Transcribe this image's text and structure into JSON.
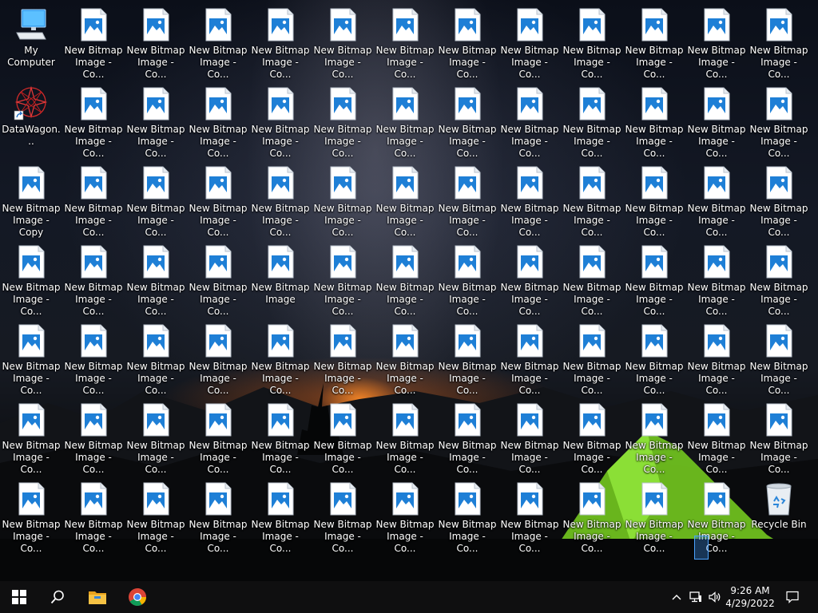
{
  "desktop": {
    "icons": [
      {
        "label": "My Computer",
        "type": "computer"
      },
      {
        "label": "New Bitmap Image - Co...",
        "type": "bitmap"
      },
      {
        "label": "New Bitmap Image - Co...",
        "type": "bitmap"
      },
      {
        "label": "New Bitmap Image - Co...",
        "type": "bitmap"
      },
      {
        "label": "New Bitmap Image - Co...",
        "type": "bitmap"
      },
      {
        "label": "New Bitmap Image - Co...",
        "type": "bitmap"
      },
      {
        "label": "New Bitmap Image - Co...",
        "type": "bitmap"
      },
      {
        "label": "New Bitmap Image - Co...",
        "type": "bitmap"
      },
      {
        "label": "New Bitmap Image - Co...",
        "type": "bitmap"
      },
      {
        "label": "New Bitmap Image - Co...",
        "type": "bitmap"
      },
      {
        "label": "New Bitmap Image - Co...",
        "type": "bitmap"
      },
      {
        "label": "New Bitmap Image - Co...",
        "type": "bitmap"
      },
      {
        "label": "New Bitmap Image - Co...",
        "type": "bitmap"
      },
      {
        "label": "DataWagon...",
        "type": "datawagon"
      },
      {
        "label": "New Bitmap Image - Co...",
        "type": "bitmap"
      },
      {
        "label": "New Bitmap Image - Co...",
        "type": "bitmap"
      },
      {
        "label": "New Bitmap Image - Co...",
        "type": "bitmap"
      },
      {
        "label": "New Bitmap Image - Co...",
        "type": "bitmap"
      },
      {
        "label": "New Bitmap Image - Co...",
        "type": "bitmap"
      },
      {
        "label": "New Bitmap Image - Co...",
        "type": "bitmap"
      },
      {
        "label": "New Bitmap Image - Co...",
        "type": "bitmap"
      },
      {
        "label": "New Bitmap Image - Co...",
        "type": "bitmap"
      },
      {
        "label": "New Bitmap Image - Co...",
        "type": "bitmap"
      },
      {
        "label": "New Bitmap Image - Co...",
        "type": "bitmap"
      },
      {
        "label": "New Bitmap Image - Co...",
        "type": "bitmap"
      },
      {
        "label": "New Bitmap Image - Co...",
        "type": "bitmap"
      },
      {
        "label": "New Bitmap Image - Copy",
        "type": "bitmap"
      },
      {
        "label": "New Bitmap Image - Co...",
        "type": "bitmap"
      },
      {
        "label": "New Bitmap Image - Co...",
        "type": "bitmap"
      },
      {
        "label": "New Bitmap Image - Co...",
        "type": "bitmap"
      },
      {
        "label": "New Bitmap Image - Co...",
        "type": "bitmap"
      },
      {
        "label": "New Bitmap Image - Co...",
        "type": "bitmap"
      },
      {
        "label": "New Bitmap Image - Co...",
        "type": "bitmap"
      },
      {
        "label": "New Bitmap Image - Co...",
        "type": "bitmap"
      },
      {
        "label": "New Bitmap Image - Co...",
        "type": "bitmap"
      },
      {
        "label": "New Bitmap Image - Co...",
        "type": "bitmap"
      },
      {
        "label": "New Bitmap Image - Co...",
        "type": "bitmap"
      },
      {
        "label": "New Bitmap Image - Co...",
        "type": "bitmap"
      },
      {
        "label": "New Bitmap Image - Co...",
        "type": "bitmap"
      },
      {
        "label": "New Bitmap Image - Co...",
        "type": "bitmap"
      },
      {
        "label": "New Bitmap Image - Co...",
        "type": "bitmap"
      },
      {
        "label": "New Bitmap Image - Co...",
        "type": "bitmap"
      },
      {
        "label": "New Bitmap Image - Co...",
        "type": "bitmap"
      },
      {
        "label": "New Bitmap Image",
        "type": "bitmap"
      },
      {
        "label": "New Bitmap Image - Co...",
        "type": "bitmap"
      },
      {
        "label": "New Bitmap Image - Co...",
        "type": "bitmap"
      },
      {
        "label": "New Bitmap Image - Co...",
        "type": "bitmap"
      },
      {
        "label": "New Bitmap Image - Co...",
        "type": "bitmap"
      },
      {
        "label": "New Bitmap Image - Co...",
        "type": "bitmap"
      },
      {
        "label": "New Bitmap Image - Co...",
        "type": "bitmap"
      },
      {
        "label": "New Bitmap Image - Co...",
        "type": "bitmap"
      },
      {
        "label": "New Bitmap Image - Co...",
        "type": "bitmap"
      },
      {
        "label": "New Bitmap Image - Co...",
        "type": "bitmap"
      },
      {
        "label": "New Bitmap Image - Co...",
        "type": "bitmap"
      },
      {
        "label": "New Bitmap Image - Co...",
        "type": "bitmap"
      },
      {
        "label": "New Bitmap Image - Co...",
        "type": "bitmap"
      },
      {
        "label": "New Bitmap Image - Co...",
        "type": "bitmap"
      },
      {
        "label": "New Bitmap Image - Co...",
        "type": "bitmap"
      },
      {
        "label": "New Bitmap Image - Co...",
        "type": "bitmap"
      },
      {
        "label": "New Bitmap Image - Co...",
        "type": "bitmap"
      },
      {
        "label": "New Bitmap Image - Co...",
        "type": "bitmap"
      },
      {
        "label": "New Bitmap Image - Co...",
        "type": "bitmap"
      },
      {
        "label": "New Bitmap Image - Co...",
        "type": "bitmap"
      },
      {
        "label": "New Bitmap Image - Co...",
        "type": "bitmap"
      },
      {
        "label": "New Bitmap Image - Co...",
        "type": "bitmap"
      },
      {
        "label": "New Bitmap Image - Co...",
        "type": "bitmap"
      },
      {
        "label": "New Bitmap Image - Co...",
        "type": "bitmap"
      },
      {
        "label": "New Bitmap Image - Co...",
        "type": "bitmap"
      },
      {
        "label": "New Bitmap Image - Co...",
        "type": "bitmap"
      },
      {
        "label": "New Bitmap Image - Co...",
        "type": "bitmap"
      },
      {
        "label": "New Bitmap Image - Co...",
        "type": "bitmap"
      },
      {
        "label": "New Bitmap Image - Co...",
        "type": "bitmap"
      },
      {
        "label": "New Bitmap Image - Co...",
        "type": "bitmap"
      },
      {
        "label": "New Bitmap Image - Co...",
        "type": "bitmap"
      },
      {
        "label": "New Bitmap Image - Co...",
        "type": "bitmap"
      },
      {
        "label": "New Bitmap Image - Co...",
        "type": "bitmap"
      },
      {
        "label": "New Bitmap Image - Co...",
        "type": "bitmap"
      },
      {
        "label": "New Bitmap Image - Co...",
        "type": "bitmap"
      },
      {
        "label": "New Bitmap Image - Co...",
        "type": "bitmap"
      },
      {
        "label": "New Bitmap Image - Co...",
        "type": "bitmap"
      },
      {
        "label": "New Bitmap Image - Co...",
        "type": "bitmap"
      },
      {
        "label": "New Bitmap Image - Co...",
        "type": "bitmap"
      },
      {
        "label": "New Bitmap Image - Co...",
        "type": "bitmap"
      },
      {
        "label": "New Bitmap Image - Co...",
        "type": "bitmap"
      },
      {
        "label": "New Bitmap Image - Co...",
        "type": "bitmap"
      },
      {
        "label": "New Bitmap Image - Co...",
        "type": "bitmap"
      },
      {
        "label": "New Bitmap Image - Co...",
        "type": "bitmap"
      },
      {
        "label": "New Bitmap Image - Co...",
        "type": "bitmap"
      },
      {
        "label": "New Bitmap Image - Co...",
        "type": "bitmap"
      },
      {
        "label": "New Bitmap Image - Co...",
        "type": "bitmap"
      },
      {
        "label": "Recycle Bin",
        "type": "recycle"
      }
    ]
  },
  "taskbar": {
    "start_icon": "windows-logo-icon",
    "search_icon": "search-icon",
    "pinned": [
      {
        "name": "file-explorer-icon"
      },
      {
        "name": "chrome-icon"
      }
    ],
    "tray": {
      "show_hidden_icon": "chevron-up-icon",
      "network_icon": "network-icon",
      "volume_icon": "speaker-icon",
      "notification_icon": "notification-icon"
    },
    "clock": {
      "time": "9:26 AM",
      "date": "4/29/2022"
    }
  },
  "colors": {
    "taskbar_bg": "#0f0f10",
    "icon_blue": "#1e7fd6",
    "tent_green": "#7ed321"
  }
}
